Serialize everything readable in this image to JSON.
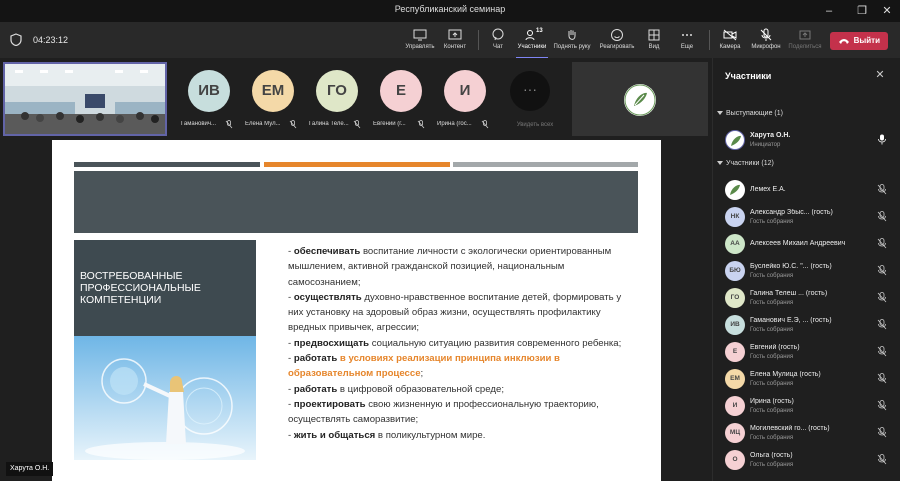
{
  "window": {
    "title": "Республиканский семинар"
  },
  "toolbar": {
    "timer": "04:23:12",
    "buttons": {
      "control": "Управлять",
      "content": "Контент",
      "chat": "Чат",
      "participants": "Участники",
      "participants_count": "13",
      "raise_hand": "Поднять руку",
      "react": "Реагировать",
      "view": "Вид",
      "more": "Еще",
      "camera": "Камера",
      "mic": "Микрофон",
      "share": "Поделиться"
    },
    "leave": "Выйти"
  },
  "strip": {
    "tiles": [
      {
        "initials": "ИВ",
        "name": "Гаманович...",
        "color": "#c7dedd"
      },
      {
        "initials": "ЕМ",
        "name": "Елена Мул...",
        "color": "#f4d9a8"
      },
      {
        "initials": "ГО",
        "name": "Галина Теле...",
        "color": "#dfe7c8"
      },
      {
        "initials": "Е",
        "name": "Евгений (г...",
        "color": "#f5d0d3"
      },
      {
        "initials": "И",
        "name": "Ирина (гос...",
        "color": "#f5d0d3"
      }
    ],
    "show_all": "Увидеть всех"
  },
  "slide": {
    "heading": "ВОСТРЕБОВАННЫЕ ПРОФЕССИОНАЛЬНЫЕ КОМПЕТЕНЦИИ",
    "bar_colors": [
      "#4a5459",
      "#e6862c",
      "#a3a8aa"
    ],
    "lines": [
      {
        "pre": "- ",
        "bold": "обеспечивать",
        "rest": " воспитание личности с экологически ориентированным мышлением, активной гражданской позицией, национальным самосознанием;"
      },
      {
        "pre": "- ",
        "bold": "осуществлять",
        "rest": " духовно-нравственное воспитание детей, формировать у них установку на здоровый образ жизни, осуществлять профилактику вредных привычек, агрессии;"
      },
      {
        "pre": "- ",
        "bold": "предвосхищать",
        "rest": " социальную ситуацию развития современного ребенка;"
      },
      {
        "pre": "- ",
        "bold": "работать",
        "orange": " в условиях реализации принципа инклюзии в образовательном процессе",
        "rest": ";"
      },
      {
        "pre": "- ",
        "bold": "работать",
        "rest": " в цифровой образовательной среде;"
      },
      {
        "pre": "- ",
        "bold": "проектировать",
        "rest": " свою жизненную и профессиональную траекторию, осуществлять саморазвитие;"
      },
      {
        "pre": "- ",
        "bold": "жить и общаться",
        "rest": " в поликультурном мире."
      }
    ],
    "presenter": "Харута О.Н."
  },
  "panel": {
    "title": "Участники",
    "presenters_header": "Выступающие (1)",
    "participants_header": "Участники (12)",
    "presenter": {
      "name": "Харута О.Н.",
      "role": "Инициатор"
    },
    "participants": [
      {
        "initials": "",
        "name": "Лемех Е.А.",
        "sub": "",
        "color": "#ffffff",
        "logo": true
      },
      {
        "initials": "НК",
        "name": "Александр Збыс... (гость)",
        "sub": "Гость собрания",
        "color": "#c9d3f0"
      },
      {
        "initials": "АА",
        "name": "Алексеев Михаил Андреевич",
        "sub": "",
        "color": "#cde6c8"
      },
      {
        "initials": "БЮ",
        "name": "Буслейко Ю.С. \"... (гость)",
        "sub": "Гость собрания",
        "color": "#c9d3f0"
      },
      {
        "initials": "ГО",
        "name": "Галина Телеш ... (гость)",
        "sub": "Гость собрания",
        "color": "#dfe7c8"
      },
      {
        "initials": "ИВ",
        "name": "Гаманович Е.Э, ... (гость)",
        "sub": "Гость собрания",
        "color": "#c7dedd"
      },
      {
        "initials": "Е",
        "name": "Евгений (гость)",
        "sub": "Гость собрания",
        "color": "#f5d0d3"
      },
      {
        "initials": "ЕМ",
        "name": "Елена Мулица (гость)",
        "sub": "Гость собрания",
        "color": "#f4d9a8"
      },
      {
        "initials": "И",
        "name": "Ирина (гость)",
        "sub": "Гость собрания",
        "color": "#f5d0d3"
      },
      {
        "initials": "МЦ",
        "name": "Могилевский го... (гость)",
        "sub": "Гость собрания",
        "color": "#f5d0d3"
      },
      {
        "initials": "О",
        "name": "Ольга (гость)",
        "sub": "Гость собрания",
        "color": "#f5d0d3"
      }
    ]
  }
}
